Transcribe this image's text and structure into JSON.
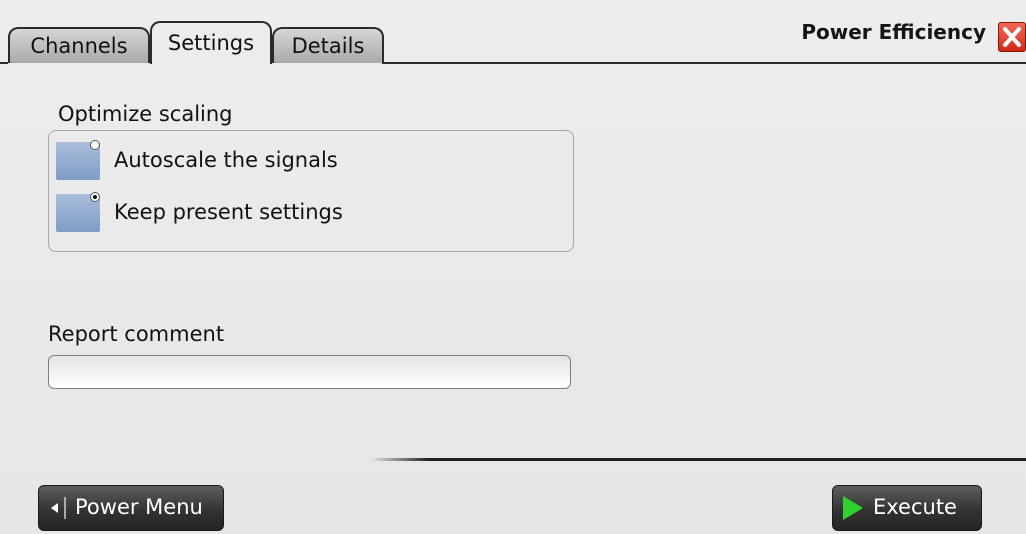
{
  "header": {
    "tabs": [
      {
        "label": "Channels",
        "active": false
      },
      {
        "label": "Settings",
        "active": true
      },
      {
        "label": "Details",
        "active": false
      }
    ],
    "title": "Power Efficiency"
  },
  "optimize_scaling": {
    "label": "Optimize scaling",
    "options": [
      {
        "label": "Autoscale the signals",
        "selected": false
      },
      {
        "label": "Keep present settings",
        "selected": true
      }
    ]
  },
  "report_comment": {
    "label": "Report comment",
    "value": "",
    "placeholder": ""
  },
  "footer": {
    "power_menu_label": "Power Menu",
    "execute_label": "Execute"
  },
  "colors": {
    "accent_radio": "#8fa9d2",
    "close_red": "#d22a18",
    "execute_arrow": "#2fd12f"
  }
}
